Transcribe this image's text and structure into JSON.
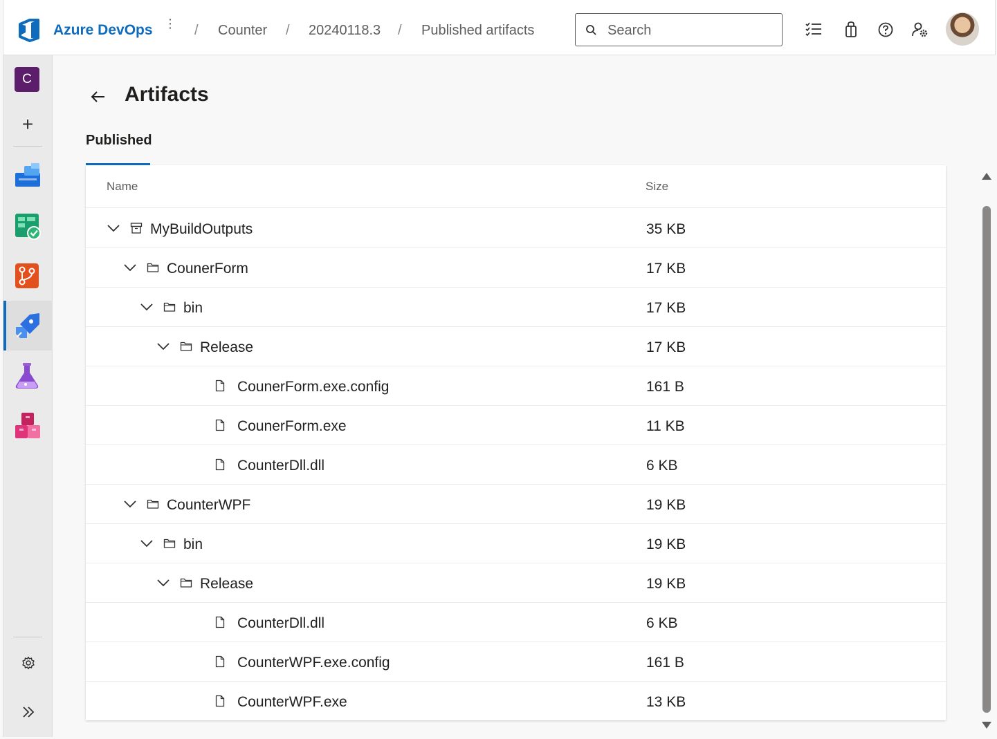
{
  "header": {
    "brand": "Azure DevOps",
    "breadcrumb": [
      "Counter",
      "20240118.3",
      "Published artifacts"
    ],
    "search_placeholder": "Search"
  },
  "sidebar": {
    "org_initial": "C",
    "items": [
      {
        "icon": "overview-icon"
      },
      {
        "icon": "boards-icon"
      },
      {
        "icon": "repos-icon"
      },
      {
        "icon": "pipelines-icon",
        "active": true
      },
      {
        "icon": "test-plans-icon"
      },
      {
        "icon": "artifacts-icon"
      }
    ]
  },
  "page": {
    "title": "Artifacts",
    "tab": "Published"
  },
  "table": {
    "columns": [
      "Name",
      "Size"
    ],
    "rows": [
      {
        "name": "MyBuildOutputs",
        "size": "35 KB",
        "type": "artifact",
        "level": 0
      },
      {
        "name": "CounerForm",
        "size": "17 KB",
        "type": "folder",
        "level": 1
      },
      {
        "name": "bin",
        "size": "17 KB",
        "type": "folder",
        "level": 2
      },
      {
        "name": "Release",
        "size": "17 KB",
        "type": "folder",
        "level": 3
      },
      {
        "name": "CounerForm.exe.config",
        "size": "161 B",
        "type": "file",
        "level": 4
      },
      {
        "name": "CounerForm.exe",
        "size": "11 KB",
        "type": "file",
        "level": 4
      },
      {
        "name": "CounterDll.dll",
        "size": "6 KB",
        "type": "file",
        "level": 4
      },
      {
        "name": "CounterWPF",
        "size": "19 KB",
        "type": "folder",
        "level": 1
      },
      {
        "name": "bin",
        "size": "19 KB",
        "type": "folder",
        "level": 2
      },
      {
        "name": "Release",
        "size": "19 KB",
        "type": "folder",
        "level": 3
      },
      {
        "name": "CounterDll.dll",
        "size": "6 KB",
        "type": "file",
        "level": 4
      },
      {
        "name": "CounterWPF.exe.config",
        "size": "161 B",
        "type": "file",
        "level": 4
      },
      {
        "name": "CounterWPF.exe",
        "size": "13 KB",
        "type": "file",
        "level": 4
      }
    ]
  },
  "colors": {
    "accent": "#0f6cbd",
    "org_tile": "#5c1e6b"
  }
}
